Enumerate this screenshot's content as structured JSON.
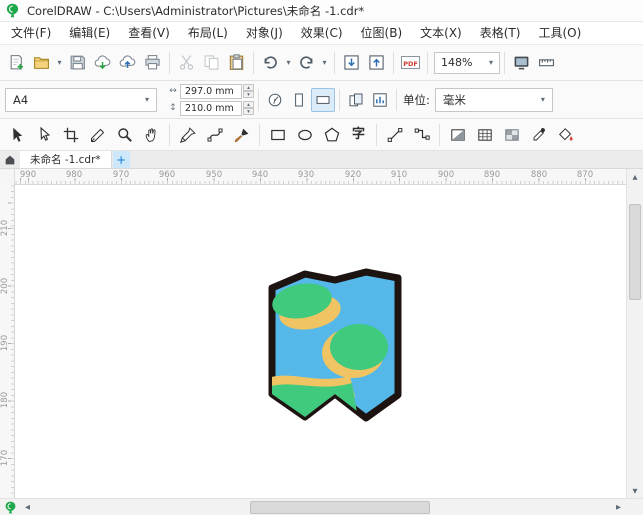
{
  "title_bar": {
    "title": "CorelDRAW - C:\\Users\\Administrator\\Pictures\\未命名 -1.cdr*"
  },
  "menu_bar": {
    "items": [
      "文件(F)",
      "编辑(E)",
      "查看(V)",
      "布局(L)",
      "对象(J)",
      "效果(C)",
      "位图(B)",
      "文本(X)",
      "表格(T)",
      "工具(O)"
    ]
  },
  "standard_toolbar": {
    "zoom_level": "148%",
    "pdf_label": "PDF"
  },
  "property_bar": {
    "page_size": "A4",
    "page_width": "297.0 mm",
    "page_height": "210.0 mm",
    "units_label": "单位:",
    "units_value": "毫米"
  },
  "toolbox": {
    "text_tool_label": "字"
  },
  "document_tabs": {
    "active_tab": "未命名 -1.cdr*",
    "new_tab_label": "+"
  },
  "rulers": {
    "horizontal": [
      "990",
      "980",
      "970",
      "960",
      "950",
      "940",
      "930",
      "920",
      "910",
      "900",
      "890",
      "880",
      "870"
    ],
    "vertical": [
      "210",
      "200",
      "190",
      "180",
      "170"
    ]
  },
  "canvas": {
    "map": {
      "sea": "#55b8e8",
      "land": "#3fca7d",
      "sand": "#f0c363",
      "outline": "#1d1412"
    }
  }
}
